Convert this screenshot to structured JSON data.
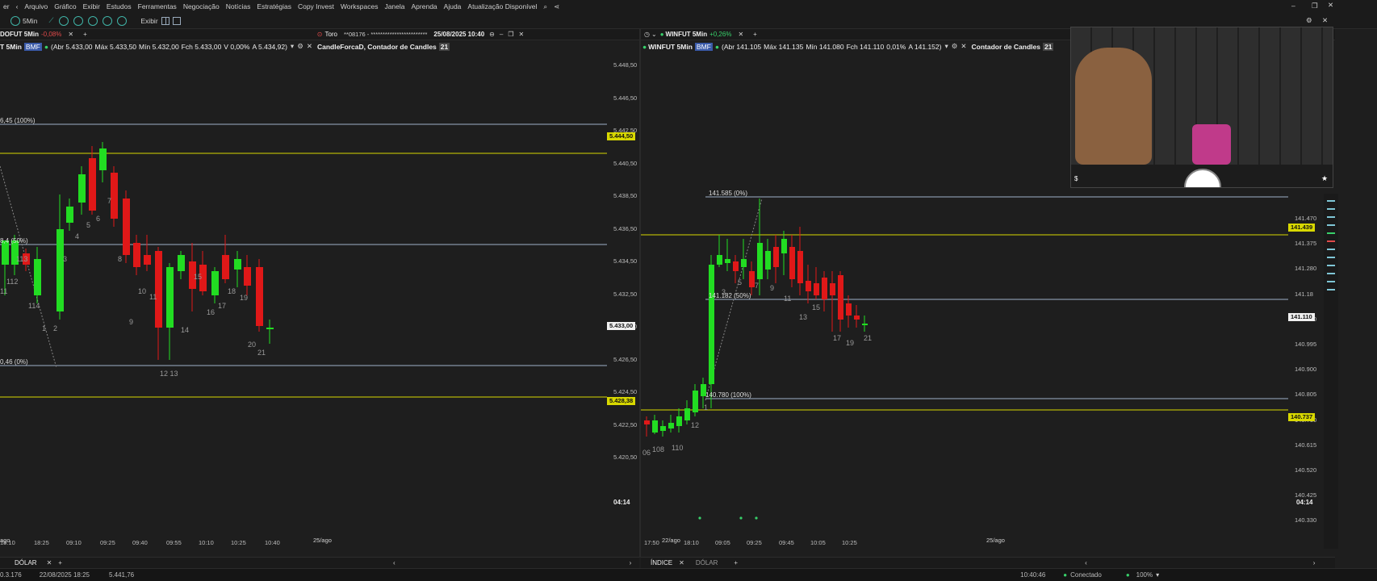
{
  "menu": {
    "items": [
      "Arquivo",
      "Gráfico",
      "Exibir",
      "Estudos",
      "Ferramentas",
      "Negociação",
      "Notícias",
      "Estratégias",
      "Copy Invest",
      "Workspaces",
      "Janela",
      "Aprenda",
      "Ajuda",
      "Atualização Disponível"
    ],
    "first": "er"
  },
  "toolbar": {
    "timeframe": "5Min",
    "exibir": "Exibir"
  },
  "left": {
    "tab_title": "DOFUT 5Min",
    "tab_change": "-0,08%",
    "broker": "Toro",
    "account": "**08176 - ************************",
    "datetime": "25/08/2025 10:40",
    "info_prefix": "T 5Min",
    "exchange": "BMF",
    "abr": "(Abr 5.433,00",
    "max": "Máx 5.433,50",
    "min": "Mín 5.432,00",
    "fch": "Fch 5.433,00",
    "var": "V 0,00%",
    "a": "A 5.434,92)",
    "studies": "CandleForcaD, Contador de Candles",
    "studies_badge": "21",
    "y_ticks": [
      "5.448,50",
      "5.446,50",
      "5.442,50",
      "5.440,50",
      "5.438,50",
      "5.436,50",
      "5.434,50",
      "5.432,50",
      "5.430,50",
      "5.426,50",
      "5.424,50",
      "5.422,50",
      "5.420,50"
    ],
    "price_tags": {
      "upper": "5.444,50",
      "current": "5.433,00",
      "lower": "5.428,38"
    },
    "fib_labels": {
      "top": "6,45 (100%)",
      "mid": "8,4 (50%)",
      "bottom": "0,46 (0%)"
    },
    "x_ticks": [
      "18:10",
      "18:25",
      "09:10",
      "09:25",
      "09:40",
      "09:55",
      "10:10",
      "10:25",
      "10:40"
    ],
    "date_left": "ago",
    "date_mid": "25/ago",
    "clock": "04:14",
    "tab_dolar": "DÓLAR",
    "candle_labels": [
      "11",
      "112",
      "113",
      "114",
      "1",
      "2",
      "3",
      "4",
      "5",
      "6",
      "7",
      "8",
      "9",
      "10",
      "11",
      "12 13",
      "14",
      "15",
      "16",
      "17",
      "18",
      "19",
      "20",
      "21"
    ]
  },
  "right": {
    "tab_title": "WINFUT 5Min",
    "tab_change": "+0,26%",
    "info_ticker": "WINFUT 5Min",
    "exchange": "BMF",
    "abr": "(Abr 141.105",
    "max": "Máx 141.135",
    "min": "Mín 141.080",
    "fch": "Fch 141.110",
    "var": "0,01%",
    "a": "A 141.152)",
    "studies": "Contador de Candles",
    "studies_badge": "21",
    "y_ticks": [
      "141.470",
      "141.375",
      "141.280",
      "141.18",
      "141.090",
      "140.995",
      "140.900",
      "140.805",
      "140.710",
      "140.615",
      "140.520",
      "140.425",
      "140.330"
    ],
    "price_tags": {
      "upper": "141.439",
      "current": "141.110",
      "lower": "140.737"
    },
    "fib_labels": {
      "top": "141.585 (0%)",
      "mid": "141.182 (50%)",
      "bottom": "140.780 (100%)"
    },
    "x_ticks": [
      "17:50",
      "18:10",
      "09:05",
      "09:25",
      "09:45",
      "10:05",
      "10:25"
    ],
    "date_left": "22/ago",
    "date_mid": "25/ago",
    "clock": "04:14",
    "tab_indice": "ÍNDICE",
    "tab_dolar": "DÓLAR",
    "candle_labels": [
      "06",
      "108",
      "110",
      "12",
      "1",
      "3",
      "5",
      "7",
      "9",
      "11",
      "13",
      "15",
      "17",
      "19",
      "21"
    ]
  },
  "status": {
    "version": "0.3.176",
    "datetime": "22/08/2025 18:25",
    "value": "5.441,76",
    "time": "10:40:46",
    "connection": "Conectado",
    "zoom": "100%"
  },
  "colors": {
    "up": "#22dd22",
    "down": "#e01818",
    "yellow_line": "#d8d800",
    "fib_line": "#9fb0c8",
    "bg": "#1e1e1e"
  }
}
